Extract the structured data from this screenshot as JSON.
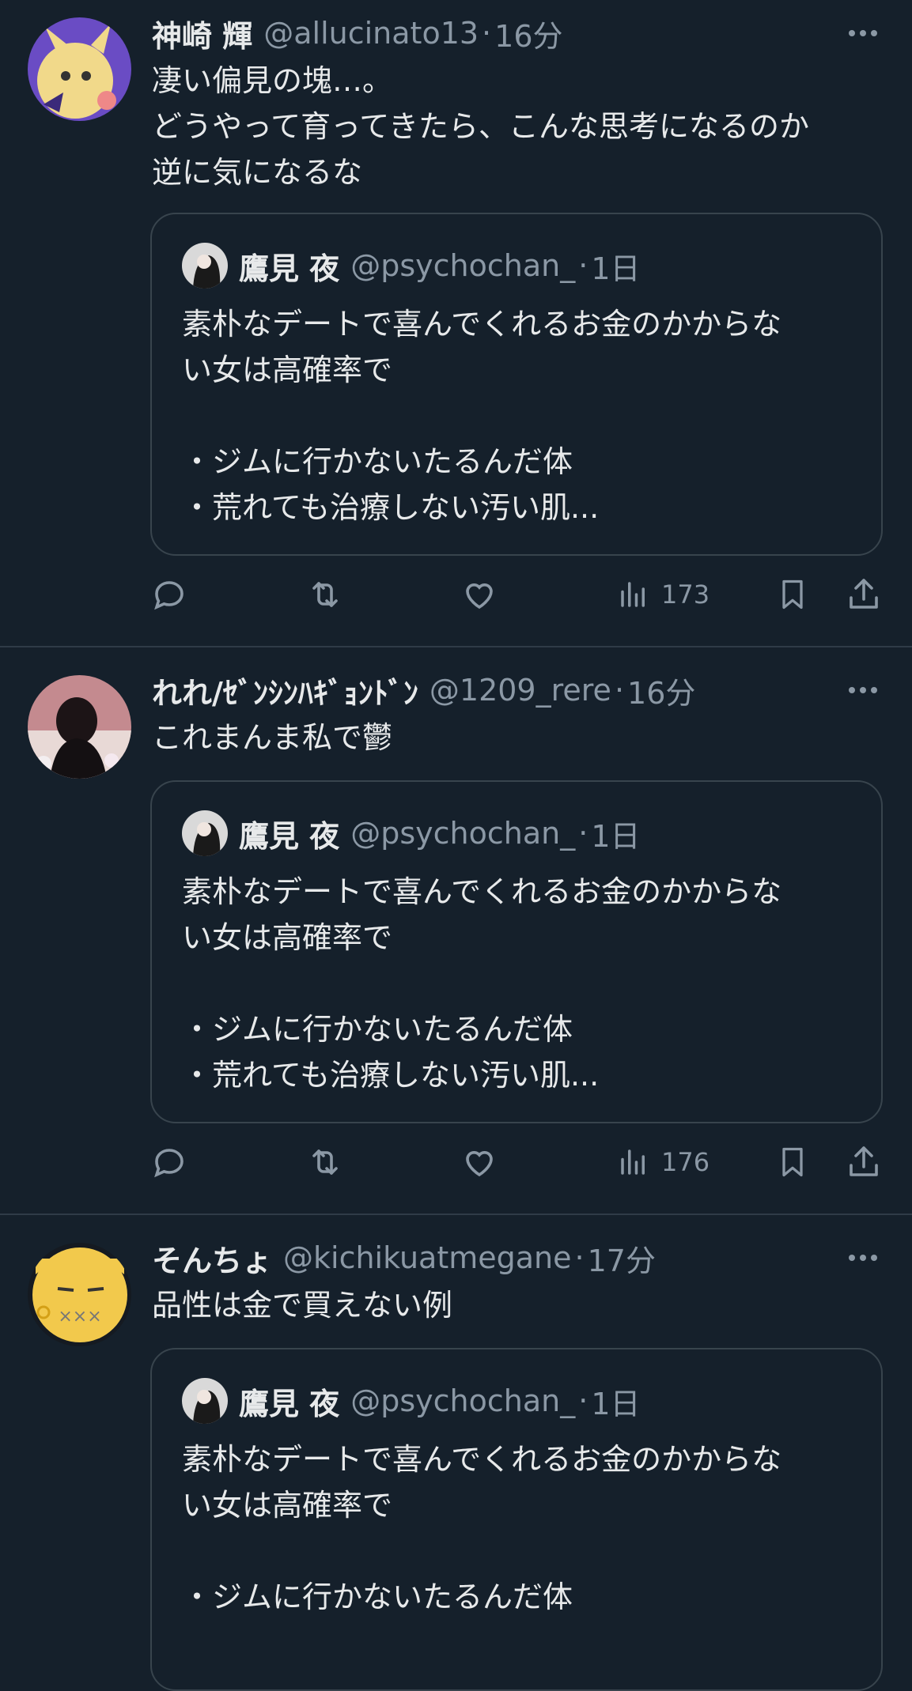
{
  "colors": {
    "background": "#15202b",
    "text": "#e7e9ea",
    "secondary": "#8b98a5",
    "border": "#38444d"
  },
  "tweets": [
    {
      "name": "神崎 輝",
      "handle": "@allucinato13",
      "separator": "·",
      "time": "16分",
      "avatar_icon": "mimikyu-avatar",
      "text": "凄い偏見の塊…。\nどうやって育ってきたら、こんな思考になるのか\n逆に気になるな",
      "quote": {
        "name": "鷹見 夜",
        "handle": "@psychochan_",
        "separator": "·",
        "time": "1日",
        "text": "素朴なデートで喜んでくれるお金のかからな\nい女は高確率で\n\n・ジムに行かないたるんだ体\n・荒れても治療しない汚い肌..."
      },
      "views": "173"
    },
    {
      "name": "れれ/ｾﾞﾝｼﾝﾊｷﾞｮﾝﾄﾞﾝ",
      "handle": "@1209_rere",
      "separator": "·",
      "time": "16分",
      "avatar_icon": "photo-avatar",
      "text": "これまんま私で鬱",
      "quote": {
        "name": "鷹見 夜",
        "handle": "@psychochan_",
        "separator": "·",
        "time": "1日",
        "text": "素朴なデートで喜んでくれるお金のかからな\nい女は高確率で\n\n・ジムに行かないたるんだ体\n・荒れても治療しない汚い肌..."
      },
      "views": "176"
    },
    {
      "name": "そんちょ",
      "handle": "@kichikuatmegane",
      "separator": "·",
      "time": "17分",
      "avatar_icon": "cartoon-face-avatar",
      "text": "品性は金で買えない例",
      "quote": {
        "name": "鷹見 夜",
        "handle": "@psychochan_",
        "separator": "·",
        "time": "1日",
        "text": "素朴なデートで喜んでくれるお金のかからな\nい女は高確率で\n\n・ジムに行かないたるんだ体"
      }
    }
  ]
}
